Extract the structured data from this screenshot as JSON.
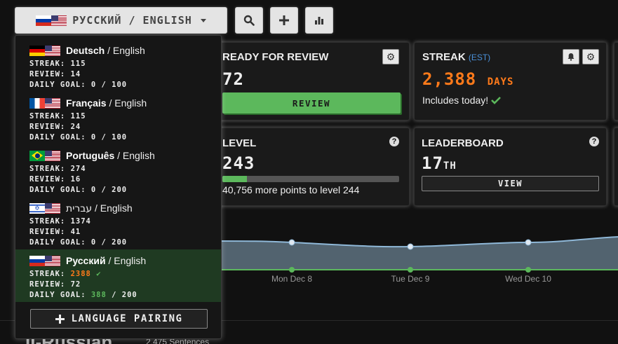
{
  "top_bar": {
    "language_toggle_label": "РУССКИЙ / ENGLISH"
  },
  "review_card": {
    "title": "READY FOR REVIEW",
    "count": "72",
    "button_label": "REVIEW"
  },
  "streak_card": {
    "title": "STREAK",
    "timezone": "(EST)",
    "value": "2,388",
    "unit": "DAYS",
    "note": "Includes today!"
  },
  "level_card": {
    "title": "LEVEL",
    "value": "243",
    "progress_fraction": 0.14,
    "note": "40,756 more points to level 244"
  },
  "leaderboard_card": {
    "title": "LEADERBOARD",
    "rank": "17",
    "rank_suffix": "TH",
    "button_label": "VIEW"
  },
  "chart": {
    "x_labels": [
      "Mon Dec 8",
      "Tue Dec 9",
      "Wed Dec 10"
    ]
  },
  "bottom": {
    "title_partial": "II-Russian",
    "sentences": "2,475 Sentences"
  },
  "dropdown": {
    "items": [
      {
        "native": "Deutsch",
        "sep": " / ",
        "base": "English",
        "streak": "STREAK: 115",
        "review": "REVIEW: 14",
        "goal": "DAILY GOAL: 0 / 100"
      },
      {
        "native": "Français",
        "sep": " / ",
        "base": "English",
        "streak": "STREAK: 115",
        "review": "REVIEW: 24",
        "goal": "DAILY GOAL: 0 / 100"
      },
      {
        "native": "Português",
        "sep": " / ",
        "base": "English",
        "streak": "STREAK: 274",
        "review": "REVIEW: 16",
        "goal": "DAILY GOAL: 0 / 200"
      },
      {
        "native": "עברית",
        "sep": " / ",
        "base": "English",
        "streak": "STREAK: 1374",
        "review": "REVIEW: 41",
        "goal": "DAILY GOAL: 0 / 200"
      }
    ],
    "active": {
      "native": "Русский",
      "sep": " / ",
      "base": "English",
      "streak_label": "STREAK: ",
      "streak_value": "2388",
      "review": "REVIEW: 72",
      "goal_label": "DAILY GOAL: ",
      "goal_value": "388",
      "goal_target": " / 200"
    },
    "add_label": "LANGUAGE PAIRING"
  },
  "colors": {
    "orange": "#ff7a1a",
    "green": "#5cb85c",
    "accent_blue": "#4a90d9"
  }
}
